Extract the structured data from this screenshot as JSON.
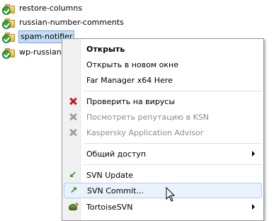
{
  "tree": [
    {
      "label": "restore-columns",
      "selected": false
    },
    {
      "label": "russian-number-comments",
      "selected": false
    },
    {
      "label": "spam-notifier",
      "selected": true
    },
    {
      "label": "wp-russian-q",
      "selected": false
    }
  ],
  "menu": {
    "items": [
      {
        "label": "Открыть",
        "bold": true
      },
      {
        "label": "Открыть в новом окне"
      },
      {
        "label": "Far Manager x64 Here"
      },
      {
        "label": "Проверить на вирусы",
        "icon": "kaspersky-icon"
      },
      {
        "label": "Посмотреть репутацию в KSN",
        "icon": "kaspersky-gray-icon",
        "disabled": true
      },
      {
        "label": "Kaspersky Application Advisor",
        "icon": "kaspersky-gray-icon",
        "disabled": true
      },
      {
        "label": "Общий доступ",
        "submenu": true
      },
      {
        "label": "SVN Update",
        "icon": "svn-update-icon"
      },
      {
        "label": "SVN Commit...",
        "icon": "svn-commit-icon",
        "hovered": true
      },
      {
        "label": "TortoiseSVN",
        "icon": "tortoisesvn-icon",
        "submenu": true
      }
    ]
  }
}
